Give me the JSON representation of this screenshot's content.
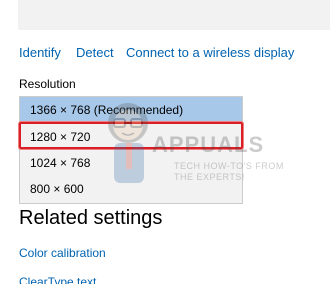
{
  "display_links": {
    "identify": "Identify",
    "detect": "Detect",
    "wireless": "Connect to a wireless display"
  },
  "resolution": {
    "label": "Resolution",
    "options": [
      "1366 × 768 (Recommended)",
      "1280 × 720",
      "1024 × 768",
      "800 × 600"
    ],
    "selected": "1366 × 768 (Recommended)",
    "highlighted": "1280 × 720"
  },
  "watermark": {
    "brand": "APPUALS",
    "tagline_1": "TECH HOW-TO'S FROM",
    "tagline_2": "THE EXPERTS!"
  },
  "related": {
    "heading": "Related settings",
    "links": [
      "Color calibration",
      "ClearType text"
    ]
  },
  "colors": {
    "link": "#0063b1",
    "selected_bg": "#a8c8ea",
    "list_bg": "#f2f2f2",
    "highlight_border": "#d81e26"
  }
}
